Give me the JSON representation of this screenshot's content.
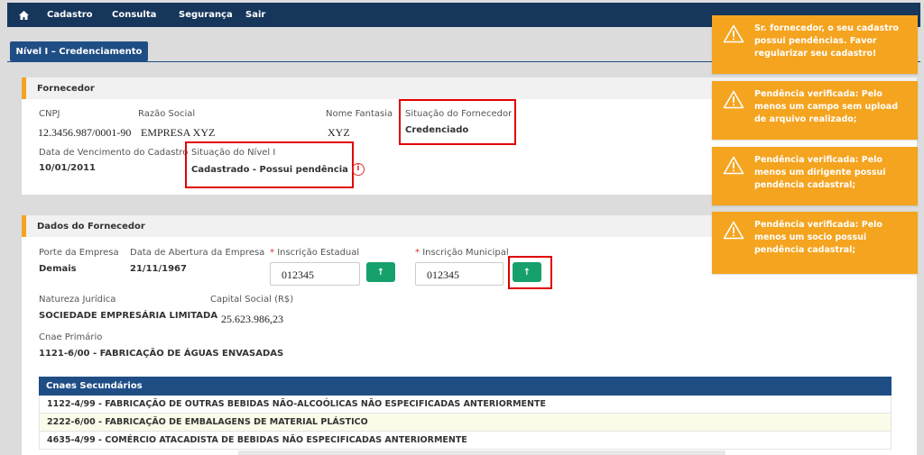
{
  "nav": {
    "items": [
      "Cadastro",
      "Consulta",
      "Segurança",
      "Sair"
    ]
  },
  "breadcrumb": {
    "label": "Nível I – Credenciamento"
  },
  "fornecedor": {
    "title": "Fornecedor",
    "cnpj_label": "CNPJ",
    "cnpj": "12.3456.987/0001-90",
    "razao_label": "Razão Social",
    "razao": "EMPRESA XYZ",
    "fantasia_label": "Nome Fantasia",
    "fantasia": "XYZ",
    "situacao_label": "Situação do Fornecedor",
    "situacao": "Credenciado",
    "vencimento_label": "Data de Vencimento do Cadastro",
    "vencimento": "10/01/2011",
    "nivel_label": "Situação do Nível I",
    "nivel": "Cadastrado - Possui pendência",
    "info_glyph": "i"
  },
  "dados": {
    "title": "Dados do Fornecedor",
    "porte_label": "Porte da Empresa",
    "porte": "Demais",
    "abertura_label": "Data de Abertura da Empresa",
    "abertura": "21/11/1967",
    "required_mark": "*",
    "ie_label": "Inscrição Estadual",
    "ie_value": "012345",
    "im_label": "Inscrição Municipal",
    "im_value": "012345",
    "upload_glyph": "↑",
    "natureza_label": "Natureza Jurídica",
    "natureza": "SOCIEDADE EMPRESÁRIA LIMITADA",
    "capital_label": "Capital Social (R$)",
    "capital": "25.623.986,23",
    "cnae_label": "Cnae Primário",
    "cnae": "1121-6/00 - FABRICAÇÃO DE ÁGUAS ENVASADAS"
  },
  "cnaes_secundarios": {
    "header": "Cnaes Secundários",
    "rows": [
      "1122-4/99 - FABRICAÇÃO DE OUTRAS BEBIDAS NÃO-ALCOÓLICAS NÃO ESPECIFICADAS ANTERIORMENTE",
      "2222-6/00 - FABRICAÇÃO DE EMBALAGENS DE MATERIAL PLÁSTICO",
      "4635-4/99 - COMÉRCIO ATACADISTA DE BEBIDAS NÃO ESPECIFICADAS ANTERIORMENTE"
    ]
  },
  "toasts": [
    "Sr. fornecedor, o seu cadastro possui pendências. Favor regularizar seu cadastro!",
    "Pendência verificada: Pelo menos um campo sem upload de arquivo realizado;",
    "Pendência verificada: Pelo menos um dirigente possui pendência cadastral;",
    "Pendência verificada: Pelo menos um socio possui pendência cadastral;"
  ],
  "colors": {
    "nav": "#16365c",
    "accent": "#f4a41f",
    "primary": "#1f4e85",
    "button": "#16a06b",
    "highlight": "#e10000"
  }
}
